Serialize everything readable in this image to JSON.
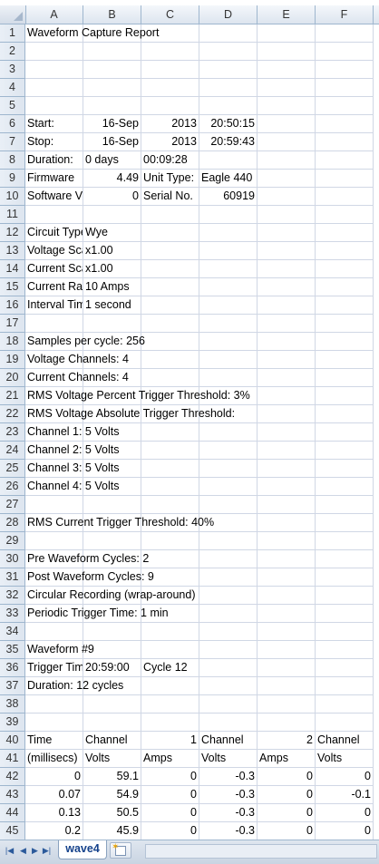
{
  "columns": [
    "A",
    "B",
    "C",
    "D",
    "E",
    "F"
  ],
  "rows": [
    {
      "n": "1",
      "cells": [
        {
          "c": "A",
          "v": "Waveform Capture Report"
        }
      ]
    },
    {
      "n": "2",
      "cells": []
    },
    {
      "n": "3",
      "cells": []
    },
    {
      "n": "4",
      "cells": []
    },
    {
      "n": "5",
      "cells": []
    },
    {
      "n": "6",
      "cells": [
        {
          "c": "A",
          "v": "Start:"
        },
        {
          "c": "B",
          "v": "16-Sep",
          "num": true
        },
        {
          "c": "C",
          "v": "2013",
          "num": true
        },
        {
          "c": "D",
          "v": "20:50:15",
          "num": true
        }
      ]
    },
    {
      "n": "7",
      "cells": [
        {
          "c": "A",
          "v": "Stop:"
        },
        {
          "c": "B",
          "v": "16-Sep",
          "num": true
        },
        {
          "c": "C",
          "v": "2013",
          "num": true
        },
        {
          "c": "D",
          "v": "20:59:43",
          "num": true
        }
      ]
    },
    {
      "n": "8",
      "cells": [
        {
          "c": "A",
          "v": "Duration:"
        },
        {
          "c": "B",
          "v": "0 days"
        },
        {
          "c": "C",
          "v": "00:09:28"
        }
      ]
    },
    {
      "n": "9",
      "cells": [
        {
          "c": "A",
          "v": "Firmware",
          "clip": true
        },
        {
          "c": "B",
          "v": "4.49",
          "num": true
        },
        {
          "c": "C",
          "v": "Unit Type:"
        },
        {
          "c": "D",
          "v": "Eagle 440"
        }
      ]
    },
    {
      "n": "10",
      "cells": [
        {
          "c": "A",
          "v": "Software Version:",
          "clip": true
        },
        {
          "c": "B",
          "v": "0",
          "num": true
        },
        {
          "c": "C",
          "v": "Serial No."
        },
        {
          "c": "D",
          "v": "60919",
          "num": true
        }
      ]
    },
    {
      "n": "11",
      "cells": []
    },
    {
      "n": "12",
      "cells": [
        {
          "c": "A",
          "v": "Circuit Type:",
          "clip": true
        },
        {
          "c": "B",
          "v": "Wye"
        }
      ]
    },
    {
      "n": "13",
      "cells": [
        {
          "c": "A",
          "v": "Voltage Scale:",
          "clip": true
        },
        {
          "c": "B",
          "v": "x1.00"
        }
      ]
    },
    {
      "n": "14",
      "cells": [
        {
          "c": "A",
          "v": "Current Scale:",
          "clip": true
        },
        {
          "c": "B",
          "v": "x1.00"
        }
      ]
    },
    {
      "n": "15",
      "cells": [
        {
          "c": "A",
          "v": "Current Range:",
          "clip": true
        },
        {
          "c": "B",
          "v": "10 Amps"
        }
      ]
    },
    {
      "n": "16",
      "cells": [
        {
          "c": "A",
          "v": "Interval Time:",
          "clip": true
        },
        {
          "c": "B",
          "v": "1 second"
        }
      ]
    },
    {
      "n": "17",
      "cells": []
    },
    {
      "n": "18",
      "cells": [
        {
          "c": "A",
          "v": "Samples per cycle:  256"
        }
      ]
    },
    {
      "n": "19",
      "cells": [
        {
          "c": "A",
          "v": "Voltage Channels:  4"
        }
      ]
    },
    {
      "n": "20",
      "cells": [
        {
          "c": "A",
          "v": "Current Channels:  4"
        }
      ]
    },
    {
      "n": "21",
      "cells": [
        {
          "c": "A",
          "v": "RMS Voltage Percent Trigger Threshold:  3%"
        }
      ]
    },
    {
      "n": "22",
      "cells": [
        {
          "c": "A",
          "v": "RMS Voltage Absolute Trigger Threshold:"
        }
      ]
    },
    {
      "n": "23",
      "cells": [
        {
          "c": "A",
          "v": "Channel 1:  5 Volts"
        }
      ]
    },
    {
      "n": "24",
      "cells": [
        {
          "c": "A",
          "v": "Channel 2:  5 Volts"
        }
      ]
    },
    {
      "n": "25",
      "cells": [
        {
          "c": "A",
          "v": "Channel 3:  5 Volts"
        }
      ]
    },
    {
      "n": "26",
      "cells": [
        {
          "c": "A",
          "v": "Channel 4:  5 Volts"
        }
      ]
    },
    {
      "n": "27",
      "cells": []
    },
    {
      "n": "28",
      "cells": [
        {
          "c": "A",
          "v": "RMS Current Trigger Threshold:  40%"
        }
      ]
    },
    {
      "n": "29",
      "cells": []
    },
    {
      "n": "30",
      "cells": [
        {
          "c": "A",
          "v": "Pre Waveform Cycles:  2"
        }
      ]
    },
    {
      "n": "31",
      "cells": [
        {
          "c": "A",
          "v": "Post Waveform Cycles:  9"
        }
      ]
    },
    {
      "n": "32",
      "cells": [
        {
          "c": "A",
          "v": "Circular Recording (wrap-around)"
        }
      ]
    },
    {
      "n": "33",
      "cells": [
        {
          "c": "A",
          "v": "Periodic Trigger Time:  1 min"
        }
      ]
    },
    {
      "n": "34",
      "cells": []
    },
    {
      "n": "35",
      "cells": [
        {
          "c": "A",
          "v": "Waveform #9"
        }
      ]
    },
    {
      "n": "36",
      "cells": [
        {
          "c": "A",
          "v": "Trigger Time:",
          "clip": true
        },
        {
          "c": "B",
          "v": "20:59:00"
        },
        {
          "c": "C",
          "v": "Cycle 12"
        }
      ]
    },
    {
      "n": "37",
      "cells": [
        {
          "c": "A",
          "v": "Duration:  12 cycles"
        }
      ]
    },
    {
      "n": "38",
      "cells": []
    },
    {
      "n": "39",
      "cells": []
    },
    {
      "n": "40",
      "cells": [
        {
          "c": "A",
          "v": "Time"
        },
        {
          "c": "B",
          "v": "Channel"
        },
        {
          "c": "C",
          "v": "1",
          "num": true
        },
        {
          "c": "D",
          "v": "Channel"
        },
        {
          "c": "E",
          "v": "2",
          "num": true
        },
        {
          "c": "F",
          "v": "Channel"
        }
      ]
    },
    {
      "n": "41",
      "cells": [
        {
          "c": "A",
          "v": "(millisecs)",
          "clip": true
        },
        {
          "c": "B",
          "v": "Volts"
        },
        {
          "c": "C",
          "v": "Amps"
        },
        {
          "c": "D",
          "v": "Volts"
        },
        {
          "c": "E",
          "v": "Amps"
        },
        {
          "c": "F",
          "v": "Volts"
        }
      ]
    },
    {
      "n": "42",
      "cells": [
        {
          "c": "A",
          "v": "0",
          "num": true
        },
        {
          "c": "B",
          "v": "59.1",
          "num": true
        },
        {
          "c": "C",
          "v": "0",
          "num": true
        },
        {
          "c": "D",
          "v": "-0.3",
          "num": true
        },
        {
          "c": "E",
          "v": "0",
          "num": true
        },
        {
          "c": "F",
          "v": "0",
          "num": true
        }
      ]
    },
    {
      "n": "43",
      "cells": [
        {
          "c": "A",
          "v": "0.07",
          "num": true
        },
        {
          "c": "B",
          "v": "54.9",
          "num": true
        },
        {
          "c": "C",
          "v": "0",
          "num": true
        },
        {
          "c": "D",
          "v": "-0.3",
          "num": true
        },
        {
          "c": "E",
          "v": "0",
          "num": true
        },
        {
          "c": "F",
          "v": "-0.1",
          "num": true
        }
      ]
    },
    {
      "n": "44",
      "cells": [
        {
          "c": "A",
          "v": "0.13",
          "num": true
        },
        {
          "c": "B",
          "v": "50.5",
          "num": true
        },
        {
          "c": "C",
          "v": "0",
          "num": true
        },
        {
          "c": "D",
          "v": "-0.3",
          "num": true
        },
        {
          "c": "E",
          "v": "0",
          "num": true
        },
        {
          "c": "F",
          "v": "0",
          "num": true
        }
      ]
    },
    {
      "n": "45",
      "cells": [
        {
          "c": "A",
          "v": "0.2",
          "num": true
        },
        {
          "c": "B",
          "v": "45.9",
          "num": true
        },
        {
          "c": "C",
          "v": "0",
          "num": true
        },
        {
          "c": "D",
          "v": "-0.3",
          "num": true
        },
        {
          "c": "E",
          "v": "0",
          "num": true
        },
        {
          "c": "F",
          "v": "0",
          "num": true
        }
      ]
    },
    {
      "n": "46",
      "cells": []
    }
  ],
  "sheet_tabs": [
    {
      "label": "wave4",
      "active": true
    }
  ],
  "nav_buttons": [
    "first-sheet",
    "prev-sheet",
    "next-sheet",
    "last-sheet"
  ],
  "colors": {
    "header_border": "#9eb6ce",
    "gridline": "#d0d7e5",
    "tab_text": "#15428b"
  }
}
